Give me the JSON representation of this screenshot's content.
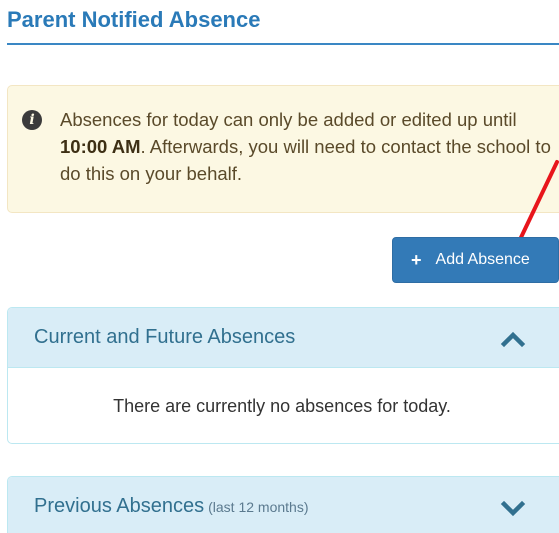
{
  "page": {
    "title": "Parent Notified Absence"
  },
  "alert": {
    "icon": "info-circle-icon",
    "text_before": "Absences for today can only be added or edited up until ",
    "time": "10:00 AM",
    "text_after": ". Afterwards, you will need to contact the school to do this on your behalf."
  },
  "actions": {
    "add_absence_label": "Add Absence",
    "add_icon": "plus-icon"
  },
  "annotation": {
    "arrow_color": "#e8151b"
  },
  "panels": {
    "current": {
      "title": "Current and Future Absences",
      "toggle_icon": "chevron-up-icon",
      "empty_message": "There are currently no absences for today."
    },
    "previous": {
      "title": "Previous Absences",
      "subtitle": "(last 12 months)",
      "toggle_icon": "chevron-down-icon"
    }
  },
  "colors": {
    "accent": "#337ab7",
    "alert_bg": "#fcf8e3",
    "panel_heading_bg": "#d9edf7"
  }
}
